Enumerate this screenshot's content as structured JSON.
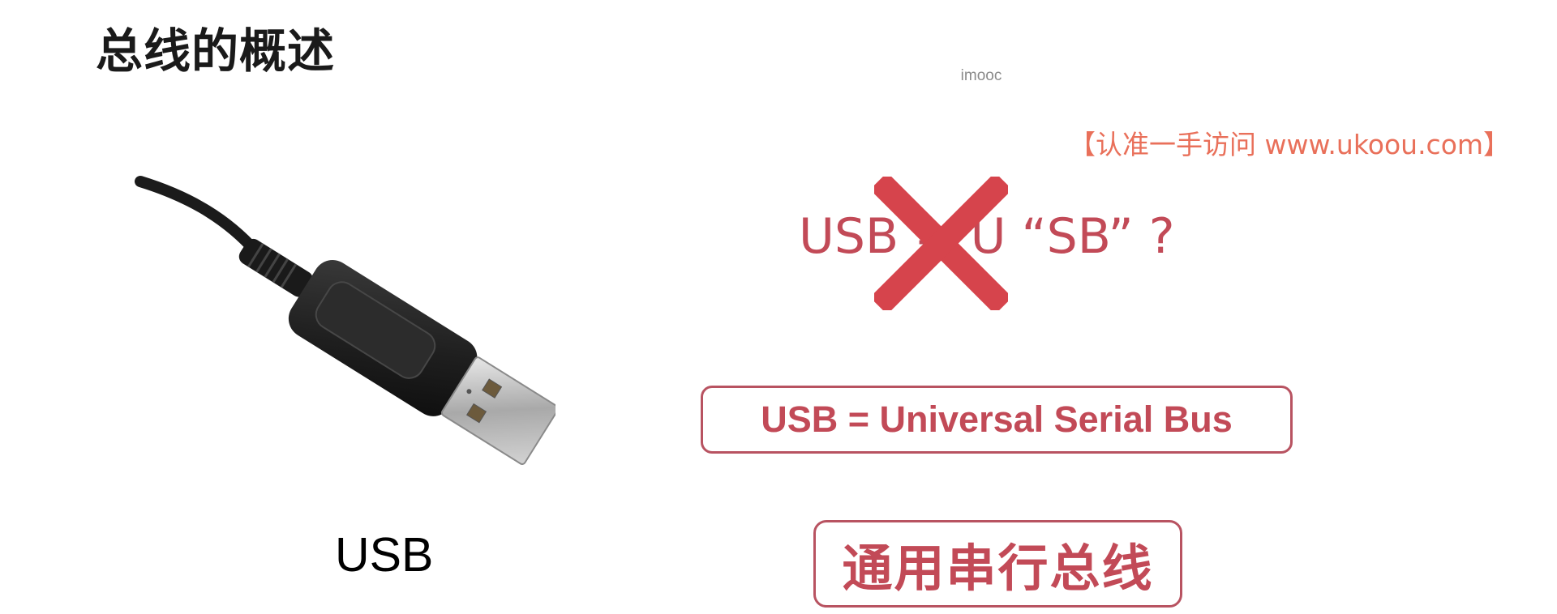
{
  "slide": {
    "title": "总线的概述",
    "watermark": "imooc",
    "banner": "【认准一手访问 www.ukoou.com】",
    "question_text": "USB = U “SB” ?",
    "definition_en": "USB = Universal Serial Bus",
    "definition_cn": "通用串行总线",
    "image_caption": "USB"
  },
  "colors": {
    "accent": "#c24a57",
    "border": "#b85361",
    "cross": "#d6444c",
    "banner": "#e9705a",
    "title": "#1a1a1a"
  },
  "icons": {
    "cross": "cross-mark-icon",
    "usb": "usb-cable-image"
  }
}
